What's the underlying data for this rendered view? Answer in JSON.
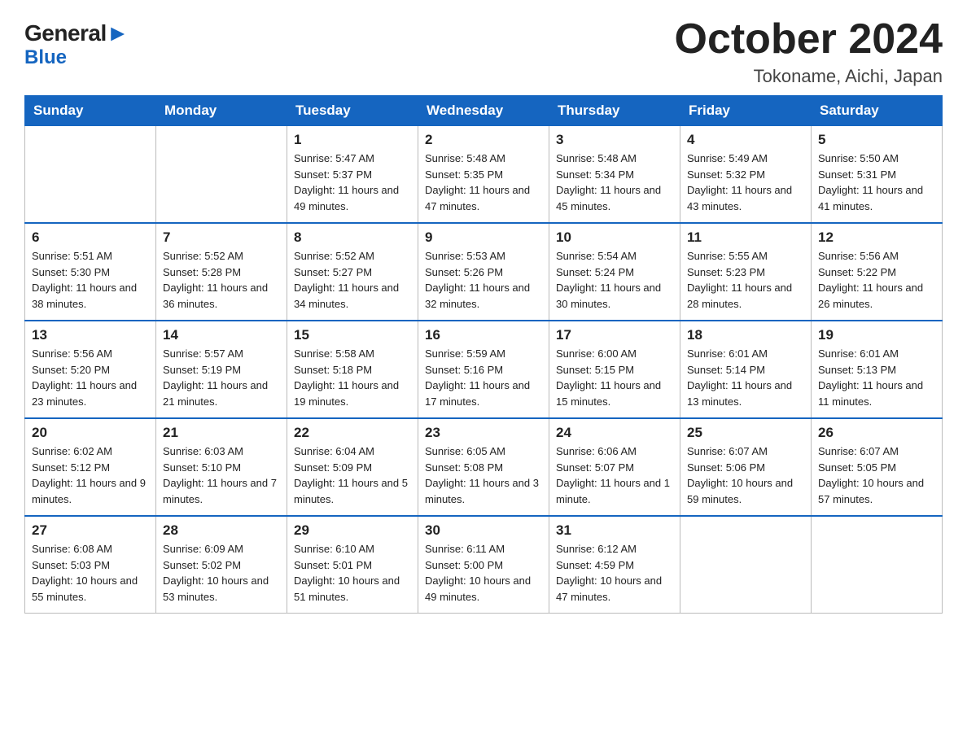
{
  "logo": {
    "general": "General",
    "blue": "Blue"
  },
  "title": "October 2024",
  "subtitle": "Tokoname, Aichi, Japan",
  "headers": [
    "Sunday",
    "Monday",
    "Tuesday",
    "Wednesday",
    "Thursday",
    "Friday",
    "Saturday"
  ],
  "weeks": [
    [
      {
        "day": "",
        "sunrise": "",
        "sunset": "",
        "daylight": ""
      },
      {
        "day": "",
        "sunrise": "",
        "sunset": "",
        "daylight": ""
      },
      {
        "day": "1",
        "sunrise": "Sunrise: 5:47 AM",
        "sunset": "Sunset: 5:37 PM",
        "daylight": "Daylight: 11 hours and 49 minutes."
      },
      {
        "day": "2",
        "sunrise": "Sunrise: 5:48 AM",
        "sunset": "Sunset: 5:35 PM",
        "daylight": "Daylight: 11 hours and 47 minutes."
      },
      {
        "day": "3",
        "sunrise": "Sunrise: 5:48 AM",
        "sunset": "Sunset: 5:34 PM",
        "daylight": "Daylight: 11 hours and 45 minutes."
      },
      {
        "day": "4",
        "sunrise": "Sunrise: 5:49 AM",
        "sunset": "Sunset: 5:32 PM",
        "daylight": "Daylight: 11 hours and 43 minutes."
      },
      {
        "day": "5",
        "sunrise": "Sunrise: 5:50 AM",
        "sunset": "Sunset: 5:31 PM",
        "daylight": "Daylight: 11 hours and 41 minutes."
      }
    ],
    [
      {
        "day": "6",
        "sunrise": "Sunrise: 5:51 AM",
        "sunset": "Sunset: 5:30 PM",
        "daylight": "Daylight: 11 hours and 38 minutes."
      },
      {
        "day": "7",
        "sunrise": "Sunrise: 5:52 AM",
        "sunset": "Sunset: 5:28 PM",
        "daylight": "Daylight: 11 hours and 36 minutes."
      },
      {
        "day": "8",
        "sunrise": "Sunrise: 5:52 AM",
        "sunset": "Sunset: 5:27 PM",
        "daylight": "Daylight: 11 hours and 34 minutes."
      },
      {
        "day": "9",
        "sunrise": "Sunrise: 5:53 AM",
        "sunset": "Sunset: 5:26 PM",
        "daylight": "Daylight: 11 hours and 32 minutes."
      },
      {
        "day": "10",
        "sunrise": "Sunrise: 5:54 AM",
        "sunset": "Sunset: 5:24 PM",
        "daylight": "Daylight: 11 hours and 30 minutes."
      },
      {
        "day": "11",
        "sunrise": "Sunrise: 5:55 AM",
        "sunset": "Sunset: 5:23 PM",
        "daylight": "Daylight: 11 hours and 28 minutes."
      },
      {
        "day": "12",
        "sunrise": "Sunrise: 5:56 AM",
        "sunset": "Sunset: 5:22 PM",
        "daylight": "Daylight: 11 hours and 26 minutes."
      }
    ],
    [
      {
        "day": "13",
        "sunrise": "Sunrise: 5:56 AM",
        "sunset": "Sunset: 5:20 PM",
        "daylight": "Daylight: 11 hours and 23 minutes."
      },
      {
        "day": "14",
        "sunrise": "Sunrise: 5:57 AM",
        "sunset": "Sunset: 5:19 PM",
        "daylight": "Daylight: 11 hours and 21 minutes."
      },
      {
        "day": "15",
        "sunrise": "Sunrise: 5:58 AM",
        "sunset": "Sunset: 5:18 PM",
        "daylight": "Daylight: 11 hours and 19 minutes."
      },
      {
        "day": "16",
        "sunrise": "Sunrise: 5:59 AM",
        "sunset": "Sunset: 5:16 PM",
        "daylight": "Daylight: 11 hours and 17 minutes."
      },
      {
        "day": "17",
        "sunrise": "Sunrise: 6:00 AM",
        "sunset": "Sunset: 5:15 PM",
        "daylight": "Daylight: 11 hours and 15 minutes."
      },
      {
        "day": "18",
        "sunrise": "Sunrise: 6:01 AM",
        "sunset": "Sunset: 5:14 PM",
        "daylight": "Daylight: 11 hours and 13 minutes."
      },
      {
        "day": "19",
        "sunrise": "Sunrise: 6:01 AM",
        "sunset": "Sunset: 5:13 PM",
        "daylight": "Daylight: 11 hours and 11 minutes."
      }
    ],
    [
      {
        "day": "20",
        "sunrise": "Sunrise: 6:02 AM",
        "sunset": "Sunset: 5:12 PM",
        "daylight": "Daylight: 11 hours and 9 minutes."
      },
      {
        "day": "21",
        "sunrise": "Sunrise: 6:03 AM",
        "sunset": "Sunset: 5:10 PM",
        "daylight": "Daylight: 11 hours and 7 minutes."
      },
      {
        "day": "22",
        "sunrise": "Sunrise: 6:04 AM",
        "sunset": "Sunset: 5:09 PM",
        "daylight": "Daylight: 11 hours and 5 minutes."
      },
      {
        "day": "23",
        "sunrise": "Sunrise: 6:05 AM",
        "sunset": "Sunset: 5:08 PM",
        "daylight": "Daylight: 11 hours and 3 minutes."
      },
      {
        "day": "24",
        "sunrise": "Sunrise: 6:06 AM",
        "sunset": "Sunset: 5:07 PM",
        "daylight": "Daylight: 11 hours and 1 minute."
      },
      {
        "day": "25",
        "sunrise": "Sunrise: 6:07 AM",
        "sunset": "Sunset: 5:06 PM",
        "daylight": "Daylight: 10 hours and 59 minutes."
      },
      {
        "day": "26",
        "sunrise": "Sunrise: 6:07 AM",
        "sunset": "Sunset: 5:05 PM",
        "daylight": "Daylight: 10 hours and 57 minutes."
      }
    ],
    [
      {
        "day": "27",
        "sunrise": "Sunrise: 6:08 AM",
        "sunset": "Sunset: 5:03 PM",
        "daylight": "Daylight: 10 hours and 55 minutes."
      },
      {
        "day": "28",
        "sunrise": "Sunrise: 6:09 AM",
        "sunset": "Sunset: 5:02 PM",
        "daylight": "Daylight: 10 hours and 53 minutes."
      },
      {
        "day": "29",
        "sunrise": "Sunrise: 6:10 AM",
        "sunset": "Sunset: 5:01 PM",
        "daylight": "Daylight: 10 hours and 51 minutes."
      },
      {
        "day": "30",
        "sunrise": "Sunrise: 6:11 AM",
        "sunset": "Sunset: 5:00 PM",
        "daylight": "Daylight: 10 hours and 49 minutes."
      },
      {
        "day": "31",
        "sunrise": "Sunrise: 6:12 AM",
        "sunset": "Sunset: 4:59 PM",
        "daylight": "Daylight: 10 hours and 47 minutes."
      },
      {
        "day": "",
        "sunrise": "",
        "sunset": "",
        "daylight": ""
      },
      {
        "day": "",
        "sunrise": "",
        "sunset": "",
        "daylight": ""
      }
    ]
  ]
}
